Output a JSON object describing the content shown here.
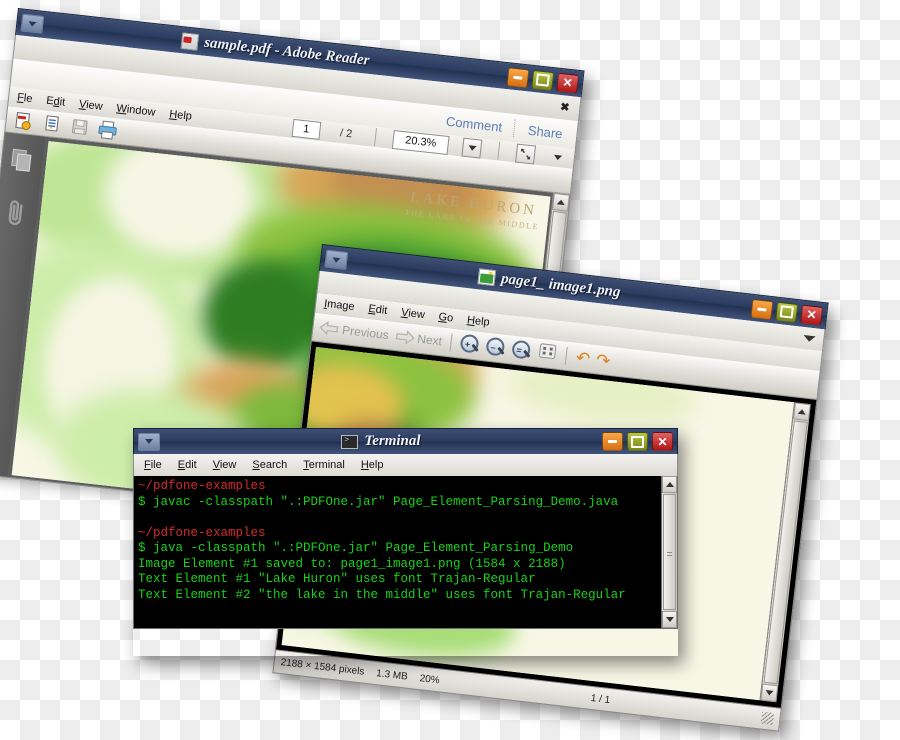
{
  "reader": {
    "title": "sample.pdf - Adobe Reader",
    "icon": "pdf-file-icon",
    "window_menu_icon": "window-menu-caret-icon",
    "close_mark": "✖",
    "buttons": {
      "minimize": "–",
      "maximize": "□",
      "close": "✕"
    },
    "tasks": {
      "comment": "Comment",
      "share": "Share"
    },
    "menus": [
      {
        "pre": "F",
        "key": "i",
        "post": "le",
        "label": "File"
      },
      {
        "pre": "E",
        "key": "d",
        "post": "it",
        "label": "Edit"
      },
      {
        "pre": "",
        "key": "V",
        "post": "iew",
        "label": "View"
      },
      {
        "pre": "",
        "key": "W",
        "post": "indow",
        "label": "Window"
      },
      {
        "pre": "",
        "key": "H",
        "post": "elp",
        "label": "Help"
      }
    ],
    "page_current": "1",
    "page_total": "/ 2",
    "zoom_value": "20.3%",
    "toolbar_icons": [
      "create-pdf-icon",
      "export-pdf-icon",
      "save-icon",
      "print-icon",
      "fit-page-icon",
      "more-tools-caret-icon"
    ],
    "sidebar_icons": [
      "page-thumbnails-icon",
      "attachments-paperclip-icon"
    ],
    "document": {
      "heading": "LAKE HURON",
      "subheading": "THE LAKE IN THE MIDDLE"
    },
    "scroll_up_icon": "scroll-up-arrow-icon",
    "scroll_down_icon": "scroll-down-arrow-icon"
  },
  "viewer": {
    "title": "page1_ image1.png",
    "icon": "image-file-icon",
    "window_menu_icon": "window-menu-caret-icon",
    "expand_icon": "chevron-down-icon",
    "buttons": {
      "minimize": "–",
      "maximize": "□",
      "close": "✕"
    },
    "menus": [
      {
        "key": "I",
        "post": "mage",
        "label": "Image"
      },
      {
        "key": "E",
        "post": "dit",
        "label": "Edit"
      },
      {
        "key": "V",
        "post": "iew",
        "label": "View"
      },
      {
        "key": "G",
        "post": "o",
        "label": "Go"
      },
      {
        "key": "H",
        "post": "elp",
        "label": "Help"
      }
    ],
    "toolbar": {
      "previous": "Previous",
      "next": "Next",
      "zoom_in": "+",
      "zoom_out": "–",
      "zoom_normal": "=",
      "fit_icon": "fit-to-window-icon",
      "rotate_left_icon": "rotate-left-icon",
      "rotate_right_icon": "rotate-right-icon",
      "rotate_left_glyph": "↶",
      "rotate_right_glyph": "↷"
    },
    "status": {
      "dimensions": "2188 × 1584 pixels",
      "filesize": "1.3 MB",
      "zoom": "20%",
      "page": "1 / 1"
    },
    "scroll_up_icon": "scroll-up-arrow-icon",
    "scroll_down_icon": "scroll-down-arrow-icon",
    "resize_grip_icon": "resize-grip-icon"
  },
  "terminal": {
    "title": "Terminal",
    "icon": "terminal-icon",
    "window_menu_icon": "window-menu-caret-icon",
    "buttons": {
      "minimize": "–",
      "maximize": "□",
      "close": "✕"
    },
    "menus": [
      {
        "key": "F",
        "post": "ile",
        "label": "File"
      },
      {
        "key": "E",
        "post": "dit",
        "label": "Edit"
      },
      {
        "key": "V",
        "post": "iew",
        "label": "View"
      },
      {
        "key": "S",
        "post": "earch",
        "label": "Search"
      },
      {
        "key": "T",
        "post": "erminal",
        "label": "Terminal"
      },
      {
        "key": "H",
        "post": "elp",
        "label": "Help"
      }
    ],
    "lines": [
      {
        "color": "red",
        "text": "~/pdfone-examples"
      },
      {
        "color": "green",
        "text": "$ javac -classpath \".:PDFOne.jar\" Page_Element_Parsing_Demo.java"
      },
      {
        "color": "green",
        "text": ""
      },
      {
        "color": "red",
        "text": "~/pdfone-examples"
      },
      {
        "color": "green",
        "text": "$ java -classpath \".:PDFOne.jar\" Page_Element_Parsing_Demo"
      },
      {
        "color": "green",
        "text": "Image Element #1 saved to: page1_image1.png (1584 x 2188)"
      },
      {
        "color": "green",
        "text": "Text Element #1 \"Lake Huron\" uses font Trajan-Regular"
      },
      {
        "color": "green",
        "text": "Text Element #2 \"the lake in the middle\" uses font Trajan-Regular"
      }
    ],
    "scroll_up_icon": "scroll-up-arrow-icon",
    "scroll_down_icon": "scroll-down-arrow-icon"
  },
  "colors": {
    "titlebar": "#2c3c60",
    "close": "#b01616",
    "minimize": "#d86f10",
    "maximize": "#76861a",
    "terminal_prompt": "#d42b2b",
    "terminal_text": "#19d219",
    "map_paper": "#f8f7e6",
    "map_green": "#3f9a2e",
    "map_light_green": "#b2e08a",
    "map_tan": "#d9a45a",
    "document_label": "#b9a878"
  }
}
